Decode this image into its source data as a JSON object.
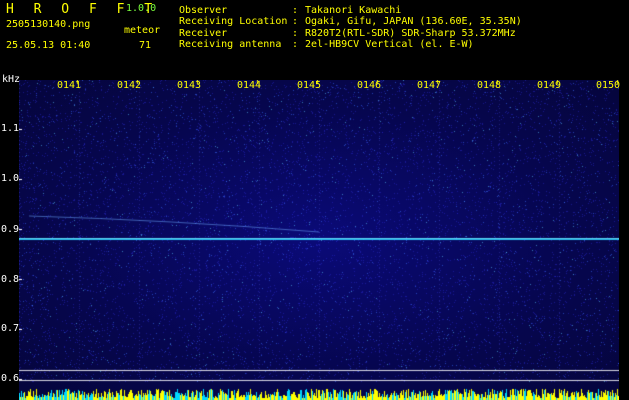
{
  "header": {
    "app_title": "H R O F F T",
    "app_version": "1.0.0",
    "filename": "2505130140.png",
    "datetime": "25.05.13 01:40",
    "meteor_label": "meteor",
    "meteor_count": "71"
  },
  "info": {
    "rows": [
      {
        "key": "Observer",
        "value": "Takanori Kawachi"
      },
      {
        "key": "Receiving Location",
        "value": "Ogaki, Gifu, JAPAN (136.60E, 35.35N)"
      },
      {
        "key": "Receiver",
        "value": "R820T2(RTL-SDR) SDR-Sharp 53.372MHz"
      },
      {
        "key": "Receiving antenna",
        "value": "2el-HB9CV Vertical (el. E-W)"
      }
    ],
    "colon": ":"
  },
  "axes": {
    "y_unit": "kHz",
    "y_ticks": [
      "1.1",
      "1.0",
      "0.9",
      "0.8",
      "0.7",
      "0.6"
    ],
    "x_ticks": [
      "0141",
      "0142",
      "0143",
      "0144",
      "0145",
      "0146",
      "0147",
      "0148",
      "0149",
      "0150"
    ]
  },
  "colors": {
    "header_yellow": "#ffff00",
    "version_green": "#7cff3c",
    "background_noise": "#06064e",
    "carrier_line": "#2ad6ff",
    "baseline_bar": "#00d8ff"
  }
}
